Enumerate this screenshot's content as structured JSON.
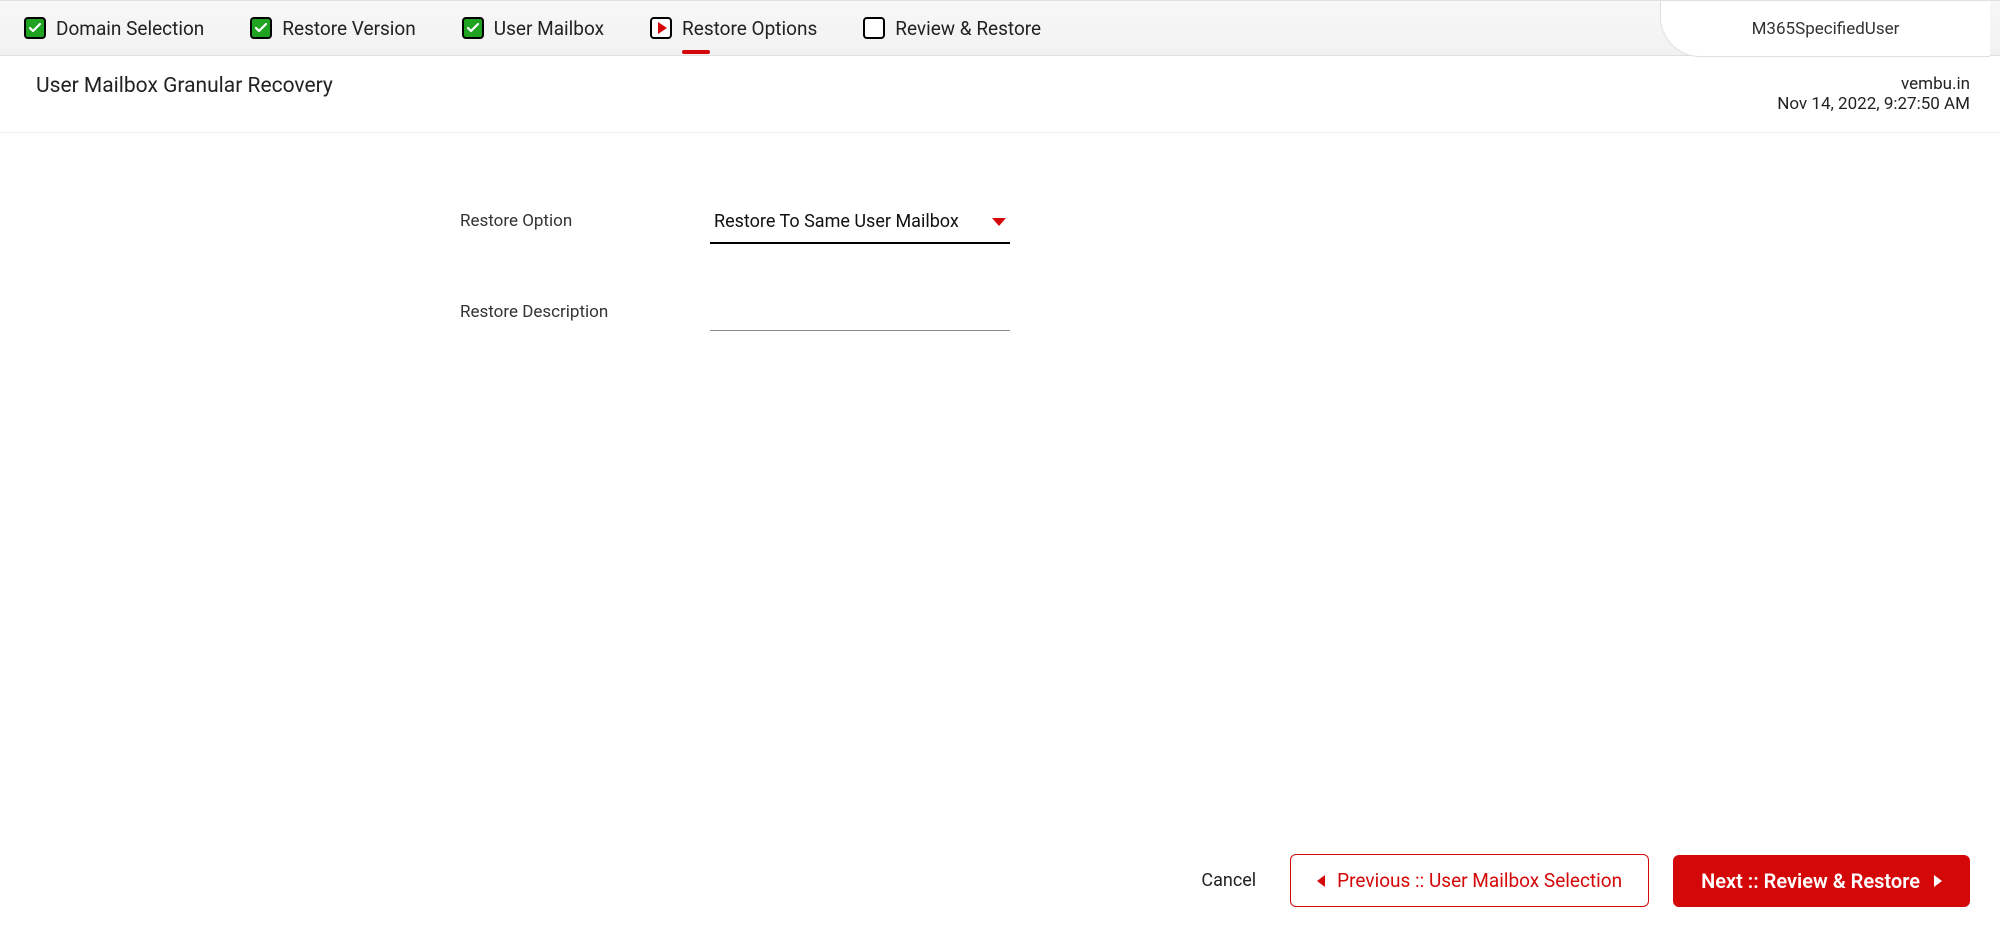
{
  "wizard": {
    "steps": [
      {
        "label": "Domain Selection",
        "state": "done"
      },
      {
        "label": "Restore Version",
        "state": "done"
      },
      {
        "label": "User Mailbox",
        "state": "done"
      },
      {
        "label": "Restore Options",
        "state": "current"
      },
      {
        "label": "Review & Restore",
        "state": "pending"
      }
    ],
    "user": "M365SpecifiedUser"
  },
  "subheader": {
    "title": "User Mailbox Granular Recovery",
    "domain": "vembu.in",
    "timestamp": "Nov 14, 2022, 9:27:50 AM"
  },
  "form": {
    "restore_option_label": "Restore Option",
    "restore_option_value": "Restore To Same User Mailbox",
    "restore_description_label": "Restore Description",
    "restore_description_value": ""
  },
  "footer": {
    "cancel": "Cancel",
    "previous": "Previous :: User Mailbox Selection",
    "next": "Next :: Review & Restore"
  }
}
